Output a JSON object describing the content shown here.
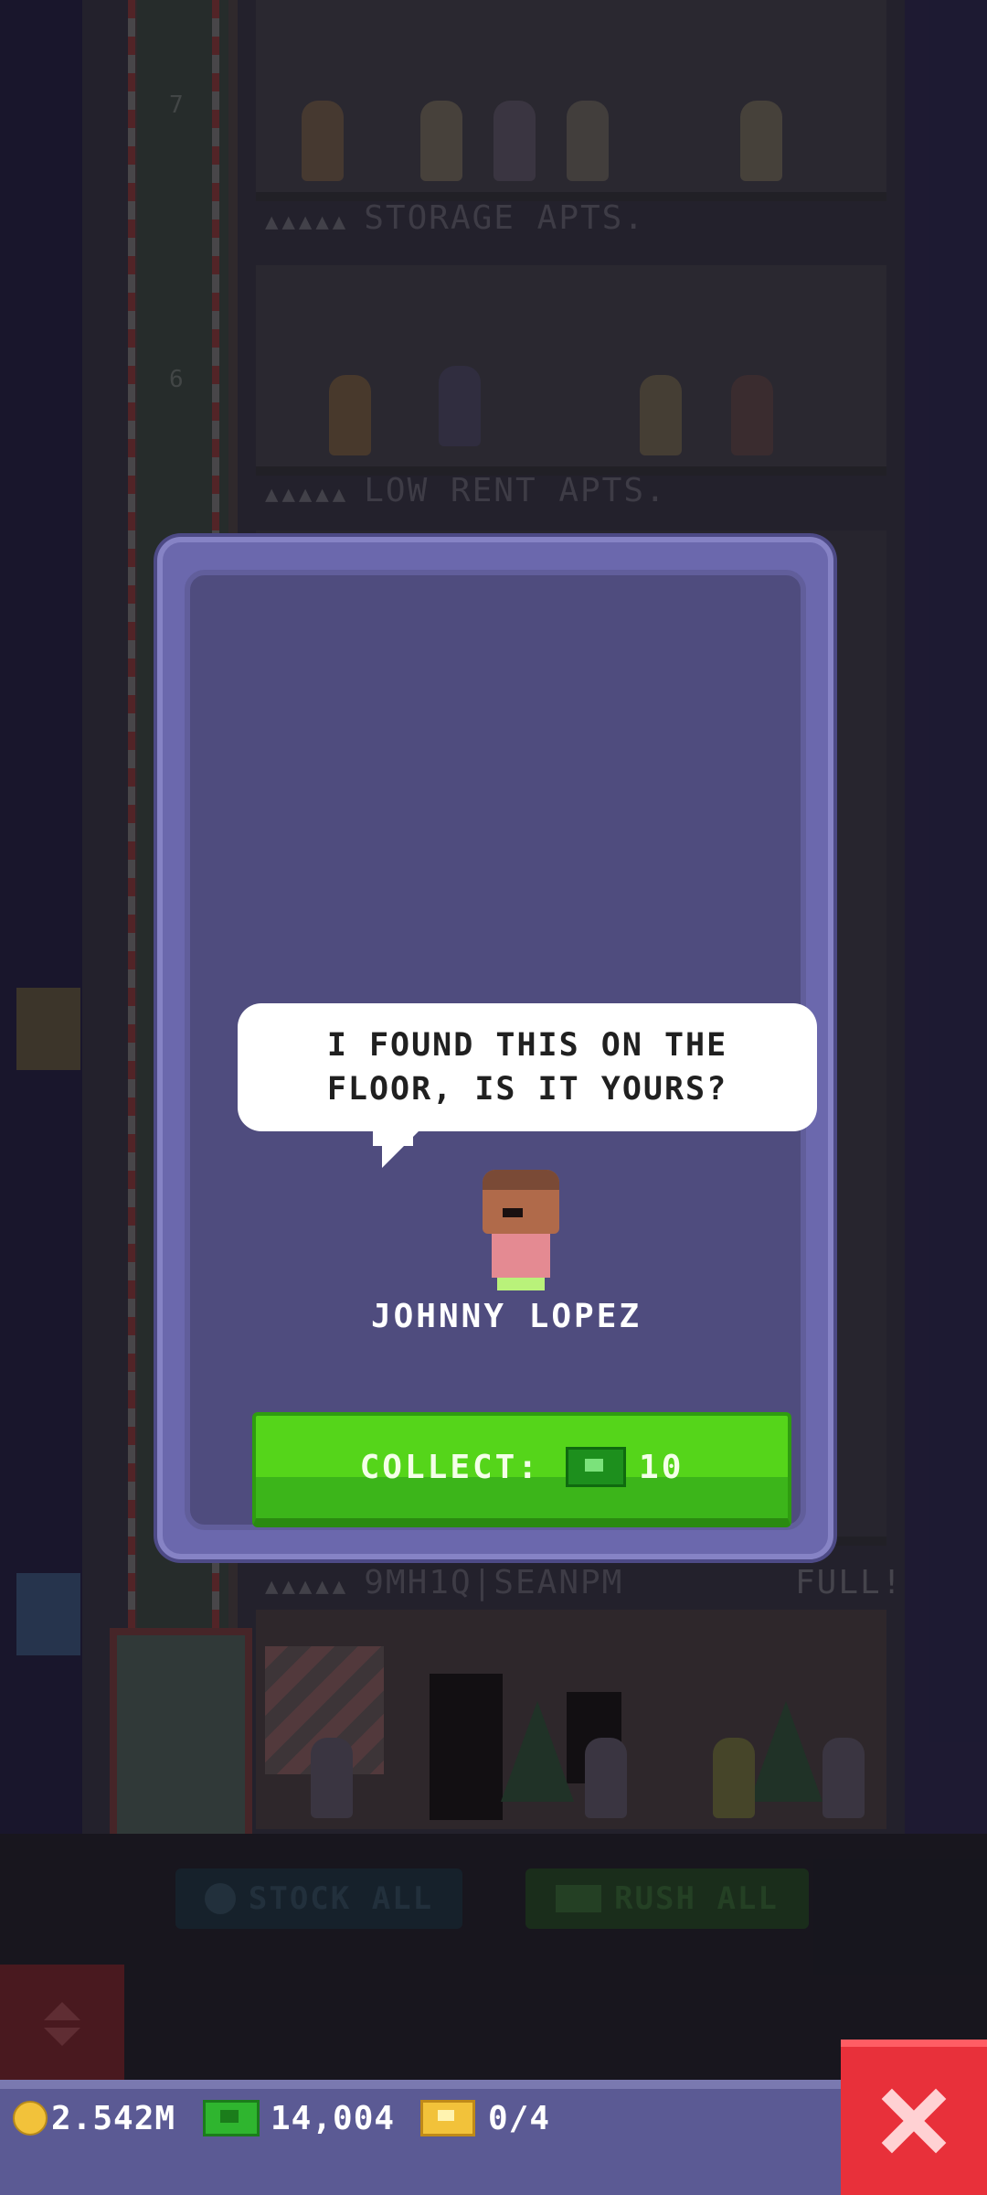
{
  "background": {
    "floors": [
      {
        "stars": "▲▲▲▲▲",
        "name": "STORAGE APTS.",
        "status": ""
      },
      {
        "stars": "▲▲▲▲▲",
        "name": "LOW RENT APTS.",
        "status": ""
      },
      {
        "stars": "▲▲▲▲▲",
        "name": "9MH1Q|SEANPM",
        "status": "FULL!"
      }
    ],
    "elevator_numbers": [
      "7",
      "6"
    ],
    "buttons": {
      "stock_all": "STOCK ALL",
      "rush_all": "RUSH ALL"
    }
  },
  "dialog": {
    "message_line1": "I FOUND THIS ON THE",
    "message_line2": "FLOOR, IS IT YOURS?",
    "character_name": "JOHNNY LOPEZ",
    "collect_label": "COLLECT:",
    "collect_amount": "10"
  },
  "status_bar": {
    "coins": "2.542M",
    "bux": "14,004",
    "tickets": "0/4"
  },
  "colors": {
    "dialog_frame": "#6b68ad",
    "dialog_inner": "#4f4c7e",
    "collect_green": "#55d51a",
    "close_red": "#e8303a",
    "status_bar": "#5b5a94"
  },
  "icons": {
    "coin": "coin-icon",
    "bux": "bux-icon",
    "ticket": "ticket-icon",
    "close": "close-icon"
  }
}
